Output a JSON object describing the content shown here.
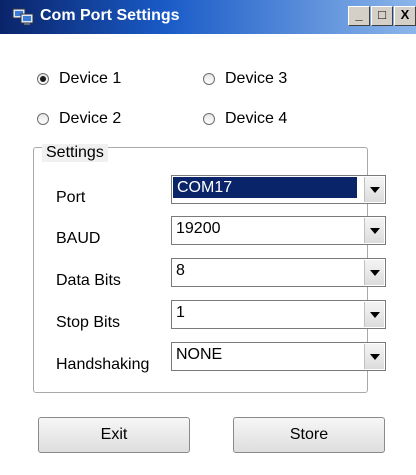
{
  "window": {
    "title": "Com Port Settings",
    "controls": {
      "minimize": "_",
      "maximize": "□",
      "close": "X"
    }
  },
  "devices": [
    {
      "label": "Device 1",
      "checked": true
    },
    {
      "label": "Device 3",
      "checked": false
    },
    {
      "label": "Device 2",
      "checked": false
    },
    {
      "label": "Device 4",
      "checked": false
    }
  ],
  "settings": {
    "legend": "Settings",
    "fields": [
      {
        "label": "Port",
        "value": "COM17",
        "selected": true
      },
      {
        "label": "BAUD",
        "value": "19200"
      },
      {
        "label": "Data Bits",
        "value": "8"
      },
      {
        "label": "Stop Bits",
        "value": "1"
      },
      {
        "label": "Handshaking",
        "value": "NONE"
      }
    ]
  },
  "buttons": {
    "exit": "Exit",
    "store": "Store"
  }
}
